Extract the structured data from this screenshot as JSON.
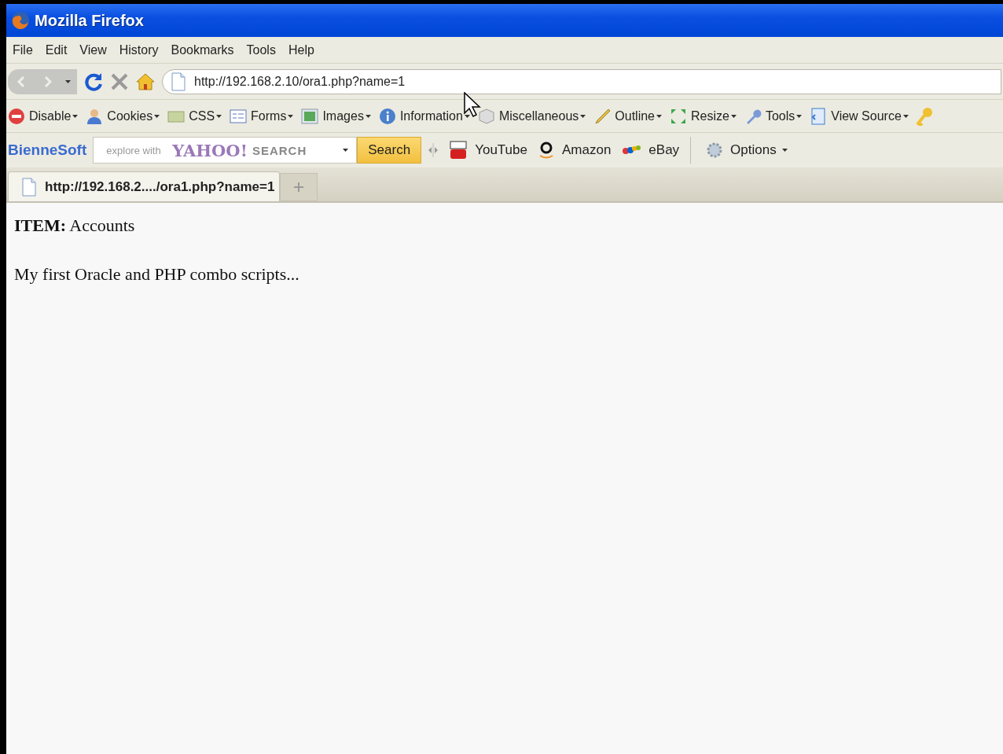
{
  "window": {
    "title": "Mozilla Firefox"
  },
  "menu": [
    {
      "label": "File"
    },
    {
      "label": "Edit"
    },
    {
      "label": "View"
    },
    {
      "label": "History"
    },
    {
      "label": "Bookmarks"
    },
    {
      "label": "Tools"
    },
    {
      "label": "Help"
    }
  ],
  "navigation": {
    "back_disabled": true,
    "forward_disabled": true,
    "url": "http://192.168.2.10/ora1.php?name=1"
  },
  "developer_toolbar": [
    {
      "label": "Disable"
    },
    {
      "label": "Cookies"
    },
    {
      "label": "CSS"
    },
    {
      "label": "Forms"
    },
    {
      "label": "Images"
    },
    {
      "label": "Information"
    },
    {
      "label": "Miscellaneous"
    },
    {
      "label": "Outline"
    },
    {
      "label": "Resize"
    },
    {
      "label": "Tools"
    },
    {
      "label": "View Source"
    }
  ],
  "search_toolbar": {
    "brand": "BienneSoft",
    "placeholder": "explore with",
    "engine_logo": "YAHOO!",
    "engine_word": "SEARCH",
    "button": "Search",
    "bookmarks": [
      {
        "label": "YouTube"
      },
      {
        "label": "Amazon"
      },
      {
        "label": "eBay"
      }
    ],
    "options": "Options"
  },
  "tabs": [
    {
      "label": "http://192.168.2..../ora1.php?name=1",
      "selected": true
    }
  ],
  "content": {
    "item_line": "**ITEM:** Accounts",
    "paragraph": "My first Oracle and PHP combo scripts..."
  }
}
